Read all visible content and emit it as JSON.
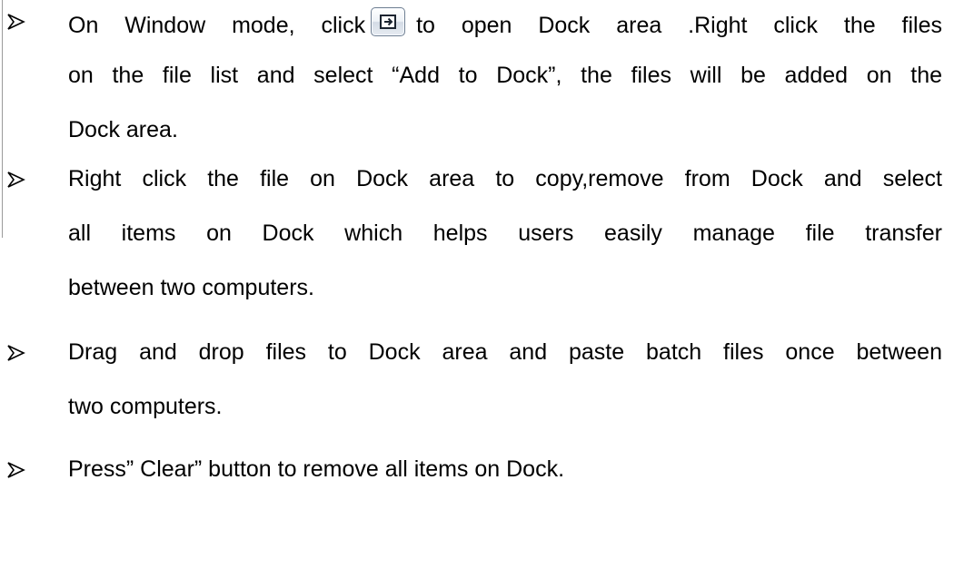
{
  "items": [
    {
      "lines": [
        {
          "before_icon": "On Window mode, click",
          "icon": "dock-toggle-icon",
          "after_icon": "to open Dock area .Right click the files"
        },
        {
          "text": "on the file list and select “Add to Dock”, the files will be added on the"
        },
        {
          "text": "Dock area."
        }
      ]
    },
    {
      "lines": [
        {
          "text": "Right click the file on Dock area to copy,remove from Dock and select"
        },
        {
          "text": "all items on Dock which helps users easily manage file transfer"
        },
        {
          "text": "between two computers."
        }
      ]
    },
    {
      "lines": [
        {
          "text": "Drag and drop files to Dock area and paste batch files once between"
        },
        {
          "text": "two computers."
        }
      ]
    },
    {
      "lines": [
        {
          "text": "Press” Clear” button to remove all items on Dock."
        }
      ]
    }
  ],
  "colors": {
    "text": "#000000",
    "rule": "#9a9a9a",
    "button_border": "#6f7f92"
  }
}
